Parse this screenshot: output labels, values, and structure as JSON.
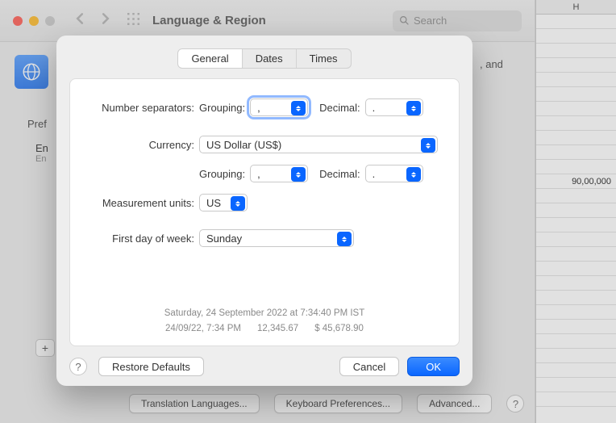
{
  "window": {
    "title": "Language & Region",
    "search_placeholder": "Search"
  },
  "background": {
    "side_text": ", and",
    "pref_label": "Pref",
    "language_primary": "En",
    "language_secondary": "En",
    "add_symbol": "+",
    "bottom_buttons": {
      "translation": "Translation Languages...",
      "keyboard": "Keyboard Preferences...",
      "advanced": "Advanced..."
    }
  },
  "spreadsheet": {
    "column": "H",
    "value": "90,00,000"
  },
  "modal": {
    "tabs": {
      "general": "General",
      "dates": "Dates",
      "times": "Times"
    },
    "labels": {
      "number_separators": "Number separators:",
      "grouping": "Grouping:",
      "decimal": "Decimal:",
      "currency": "Currency:",
      "measurement": "Measurement units:",
      "first_day": "First day of week:"
    },
    "values": {
      "num_grouping": ",",
      "num_decimal": ".",
      "currency": "US Dollar (US$)",
      "cur_grouping": ",",
      "cur_decimal": ".",
      "measurement": "US",
      "first_day": "Sunday"
    },
    "preview": {
      "line1": "Saturday, 24 September 2022 at 7:34:40 PM IST",
      "date_short": "24/09/22, 7:34 PM",
      "number": "12,345.67",
      "currency_sample": "$ 45,678.90"
    },
    "buttons": {
      "restore": "Restore Defaults",
      "cancel": "Cancel",
      "ok": "OK",
      "help": "?"
    }
  }
}
